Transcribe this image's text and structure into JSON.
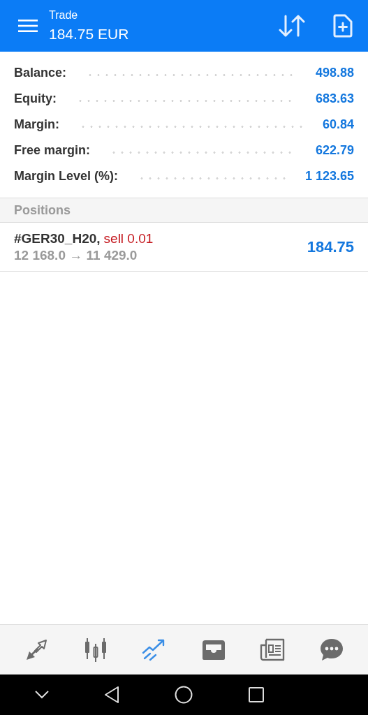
{
  "header": {
    "title": "Trade",
    "subtitle": "184.75 EUR"
  },
  "summary": [
    {
      "label": "Balance:",
      "value": "498.88"
    },
    {
      "label": "Equity:",
      "value": "683.63"
    },
    {
      "label": "Margin:",
      "value": "60.84"
    },
    {
      "label": "Free margin:",
      "value": "622.79"
    },
    {
      "label": "Margin Level (%):",
      "value": "1 123.65"
    }
  ],
  "positions": {
    "heading": "Positions",
    "rows": [
      {
        "symbol": "#GER30_H20,",
        "order": "sell 0.01",
        "prices": "12 168.0 → 11 429.0",
        "profit": "184.75"
      }
    ]
  },
  "tabs": [
    {
      "kind": "quotes",
      "selected": false
    },
    {
      "kind": "chart",
      "selected": false
    },
    {
      "kind": "trade",
      "selected": true
    },
    {
      "kind": "history",
      "selected": false
    },
    {
      "kind": "news",
      "selected": false
    },
    {
      "kind": "chat",
      "selected": false
    }
  ]
}
